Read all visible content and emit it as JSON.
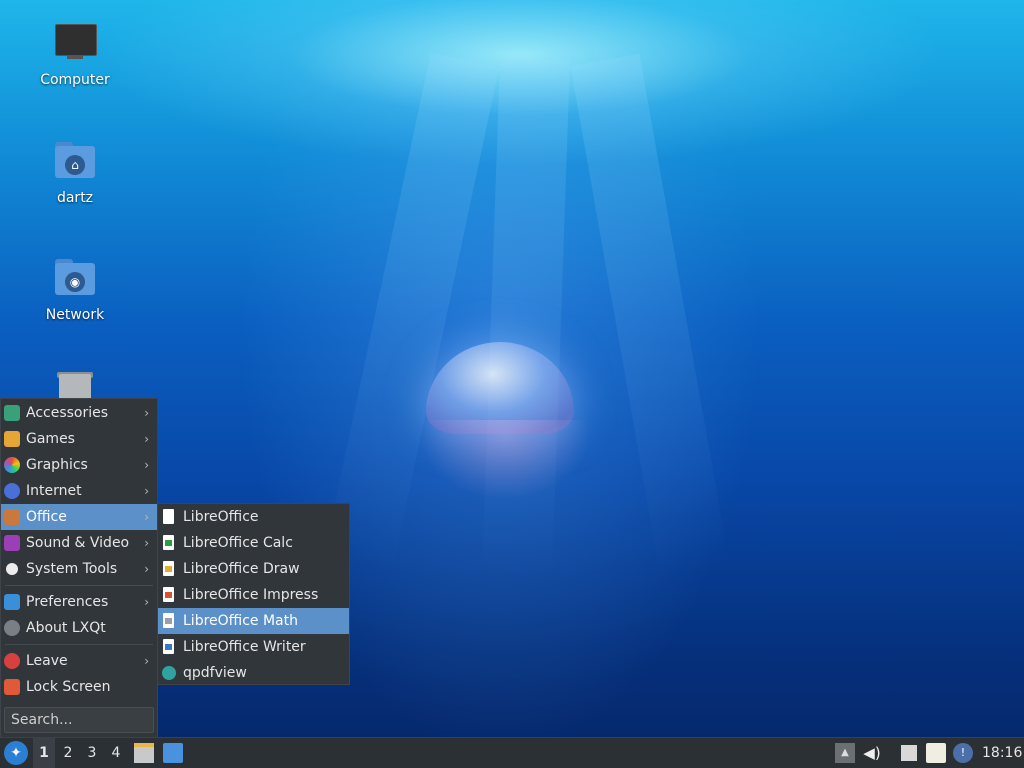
{
  "desktop": {
    "icons": [
      {
        "label": "Computer",
        "icon": "computer-icon"
      },
      {
        "label": "dartz",
        "icon": "home-folder-icon"
      },
      {
        "label": "Network",
        "icon": "network-folder-icon"
      },
      {
        "label": "",
        "icon": "trash-icon"
      }
    ]
  },
  "menu": {
    "items": [
      {
        "label": "Accessories",
        "icon": "accessories-icon",
        "has_submenu": true
      },
      {
        "label": "Games",
        "icon": "games-icon",
        "has_submenu": true
      },
      {
        "label": "Graphics",
        "icon": "graphics-icon",
        "has_submenu": true
      },
      {
        "label": "Internet",
        "icon": "internet-icon",
        "has_submenu": true
      },
      {
        "label": "Office",
        "icon": "office-icon",
        "has_submenu": true,
        "active": true
      },
      {
        "label": "Sound & Video",
        "icon": "sound-video-icon",
        "has_submenu": true
      },
      {
        "label": "System Tools",
        "icon": "system-tools-icon",
        "has_submenu": true
      },
      {
        "label": "Preferences",
        "icon": "preferences-icon",
        "has_submenu": true
      },
      {
        "label": "About LXQt",
        "icon": "info-icon",
        "has_submenu": false
      },
      {
        "label": "Leave",
        "icon": "power-icon",
        "has_submenu": true
      },
      {
        "label": "Lock Screen",
        "icon": "lock-icon",
        "has_submenu": false
      }
    ],
    "search_placeholder": "Search..."
  },
  "office_submenu": {
    "items": [
      {
        "label": "LibreOffice",
        "icon": "libreoffice-icon"
      },
      {
        "label": "LibreOffice Calc",
        "icon": "libreoffice-calc-icon"
      },
      {
        "label": "LibreOffice Draw",
        "icon": "libreoffice-draw-icon"
      },
      {
        "label": "LibreOffice Impress",
        "icon": "libreoffice-impress-icon"
      },
      {
        "label": "LibreOffice Math",
        "icon": "libreoffice-math-icon",
        "active": true
      },
      {
        "label": "LibreOffice Writer",
        "icon": "libreoffice-writer-icon"
      },
      {
        "label": "qpdfview",
        "icon": "qpdfview-icon"
      }
    ]
  },
  "taskbar": {
    "workspaces": [
      "1",
      "2",
      "3",
      "4"
    ],
    "active_workspace": "1",
    "clock": "18:16"
  },
  "colors": {
    "menu_bg": "#31363b",
    "highlight": "#5c90c8",
    "taskbar_bg": "#2b3034"
  }
}
